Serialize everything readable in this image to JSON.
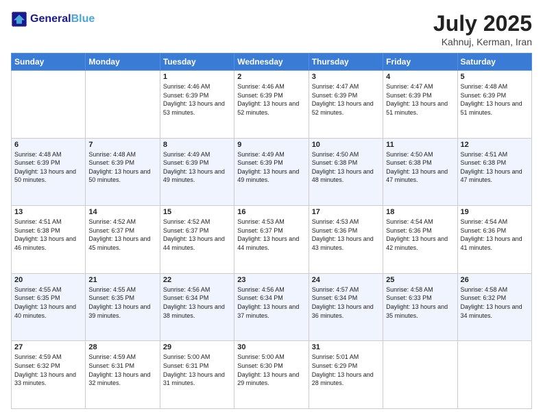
{
  "header": {
    "logo_general": "General",
    "logo_blue": "Blue",
    "month_title": "July 2025",
    "location": "Kahnuj, Kerman, Iran"
  },
  "days_of_week": [
    "Sunday",
    "Monday",
    "Tuesday",
    "Wednesday",
    "Thursday",
    "Friday",
    "Saturday"
  ],
  "weeks": [
    [
      {
        "day": "",
        "info": ""
      },
      {
        "day": "",
        "info": ""
      },
      {
        "day": "1",
        "info": "Sunrise: 4:46 AM\nSunset: 6:39 PM\nDaylight: 13 hours and 53 minutes."
      },
      {
        "day": "2",
        "info": "Sunrise: 4:46 AM\nSunset: 6:39 PM\nDaylight: 13 hours and 52 minutes."
      },
      {
        "day": "3",
        "info": "Sunrise: 4:47 AM\nSunset: 6:39 PM\nDaylight: 13 hours and 52 minutes."
      },
      {
        "day": "4",
        "info": "Sunrise: 4:47 AM\nSunset: 6:39 PM\nDaylight: 13 hours and 51 minutes."
      },
      {
        "day": "5",
        "info": "Sunrise: 4:48 AM\nSunset: 6:39 PM\nDaylight: 13 hours and 51 minutes."
      }
    ],
    [
      {
        "day": "6",
        "info": "Sunrise: 4:48 AM\nSunset: 6:39 PM\nDaylight: 13 hours and 50 minutes."
      },
      {
        "day": "7",
        "info": "Sunrise: 4:48 AM\nSunset: 6:39 PM\nDaylight: 13 hours and 50 minutes."
      },
      {
        "day": "8",
        "info": "Sunrise: 4:49 AM\nSunset: 6:39 PM\nDaylight: 13 hours and 49 minutes."
      },
      {
        "day": "9",
        "info": "Sunrise: 4:49 AM\nSunset: 6:39 PM\nDaylight: 13 hours and 49 minutes."
      },
      {
        "day": "10",
        "info": "Sunrise: 4:50 AM\nSunset: 6:38 PM\nDaylight: 13 hours and 48 minutes."
      },
      {
        "day": "11",
        "info": "Sunrise: 4:50 AM\nSunset: 6:38 PM\nDaylight: 13 hours and 47 minutes."
      },
      {
        "day": "12",
        "info": "Sunrise: 4:51 AM\nSunset: 6:38 PM\nDaylight: 13 hours and 47 minutes."
      }
    ],
    [
      {
        "day": "13",
        "info": "Sunrise: 4:51 AM\nSunset: 6:38 PM\nDaylight: 13 hours and 46 minutes."
      },
      {
        "day": "14",
        "info": "Sunrise: 4:52 AM\nSunset: 6:37 PM\nDaylight: 13 hours and 45 minutes."
      },
      {
        "day": "15",
        "info": "Sunrise: 4:52 AM\nSunset: 6:37 PM\nDaylight: 13 hours and 44 minutes."
      },
      {
        "day": "16",
        "info": "Sunrise: 4:53 AM\nSunset: 6:37 PM\nDaylight: 13 hours and 44 minutes."
      },
      {
        "day": "17",
        "info": "Sunrise: 4:53 AM\nSunset: 6:36 PM\nDaylight: 13 hours and 43 minutes."
      },
      {
        "day": "18",
        "info": "Sunrise: 4:54 AM\nSunset: 6:36 PM\nDaylight: 13 hours and 42 minutes."
      },
      {
        "day": "19",
        "info": "Sunrise: 4:54 AM\nSunset: 6:36 PM\nDaylight: 13 hours and 41 minutes."
      }
    ],
    [
      {
        "day": "20",
        "info": "Sunrise: 4:55 AM\nSunset: 6:35 PM\nDaylight: 13 hours and 40 minutes."
      },
      {
        "day": "21",
        "info": "Sunrise: 4:55 AM\nSunset: 6:35 PM\nDaylight: 13 hours and 39 minutes."
      },
      {
        "day": "22",
        "info": "Sunrise: 4:56 AM\nSunset: 6:34 PM\nDaylight: 13 hours and 38 minutes."
      },
      {
        "day": "23",
        "info": "Sunrise: 4:56 AM\nSunset: 6:34 PM\nDaylight: 13 hours and 37 minutes."
      },
      {
        "day": "24",
        "info": "Sunrise: 4:57 AM\nSunset: 6:34 PM\nDaylight: 13 hours and 36 minutes."
      },
      {
        "day": "25",
        "info": "Sunrise: 4:58 AM\nSunset: 6:33 PM\nDaylight: 13 hours and 35 minutes."
      },
      {
        "day": "26",
        "info": "Sunrise: 4:58 AM\nSunset: 6:32 PM\nDaylight: 13 hours and 34 minutes."
      }
    ],
    [
      {
        "day": "27",
        "info": "Sunrise: 4:59 AM\nSunset: 6:32 PM\nDaylight: 13 hours and 33 minutes."
      },
      {
        "day": "28",
        "info": "Sunrise: 4:59 AM\nSunset: 6:31 PM\nDaylight: 13 hours and 32 minutes."
      },
      {
        "day": "29",
        "info": "Sunrise: 5:00 AM\nSunset: 6:31 PM\nDaylight: 13 hours and 31 minutes."
      },
      {
        "day": "30",
        "info": "Sunrise: 5:00 AM\nSunset: 6:30 PM\nDaylight: 13 hours and 29 minutes."
      },
      {
        "day": "31",
        "info": "Sunrise: 5:01 AM\nSunset: 6:29 PM\nDaylight: 13 hours and 28 minutes."
      },
      {
        "day": "",
        "info": ""
      },
      {
        "day": "",
        "info": ""
      }
    ]
  ]
}
